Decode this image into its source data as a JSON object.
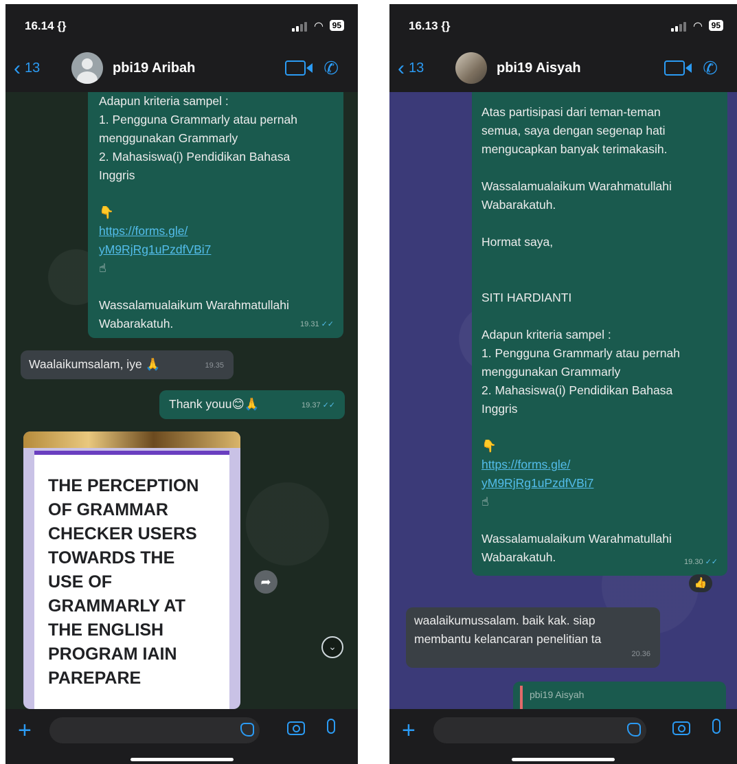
{
  "colors": {
    "accent": "#2b9bf4",
    "out_bubble": "#1a5a4e",
    "in_bubble": "#3a4045",
    "link": "#53bdeb"
  },
  "left": {
    "status": {
      "time": "16.14 {}",
      "battery": "95"
    },
    "header": {
      "back_count": "13",
      "contact_name": "pbi19 Aribah"
    },
    "msg1": {
      "lines": [
        "Adapun kriteria sampel :",
        "1. Pengguna Grammarly atau pernah",
        "menggunakan Grammarly",
        "2. Mahasiswa(i) Pendidikan Bahasa",
        "Inggris",
        "",
        "👇",
        "https://forms.gle/",
        "yM9RjRg1uPzdfVBi7",
        "☝",
        "",
        "Wassalamualaikum Warahmatullahi",
        "Wabarakatuh."
      ],
      "time": "19.31"
    },
    "msg2": {
      "text": "Waalaikumsalam, iye 🙏",
      "time": "19.35"
    },
    "msg3": {
      "text": "Thank youu😊🙏",
      "time": "19.37"
    },
    "card": {
      "title_lines": [
        "THE PERCEPTION",
        "OF GRAMMAR",
        "CHECKER USERS",
        "TOWARDS THE",
        "USE OF",
        "GRAMMARLY AT",
        "THE ENGLISH",
        "PROGRAM IAIN",
        "PAREPARE"
      ]
    }
  },
  "right": {
    "status": {
      "time": "16.13 {}",
      "battery": "95"
    },
    "header": {
      "back_count": "13",
      "contact_name": "pbi19 Aisyah"
    },
    "msg1": {
      "lines": [
        "Atas partisipasi dari teman-teman",
        "semua, saya dengan segenap hati",
        "mengucapkan banyak terimakasih.",
        "",
        "Wassalamualaikum Warahmatullahi",
        "Wabarakatuh.",
        "",
        "Hormat saya,",
        "",
        "",
        "SITI HARDIANTI",
        "",
        "Adapun kriteria sampel :",
        "1. Pengguna Grammarly atau pernah",
        "menggunakan Grammarly",
        "2. Mahasiswa(i) Pendidikan Bahasa",
        "Inggris",
        "",
        "👇",
        "https://forms.gle/",
        "yM9RjRg1uPzdfVBi7",
        "☝",
        "",
        "Wassalamualaikum Warahmatullahi",
        "Wabarakatuh."
      ],
      "time": "19.30",
      "reaction": "👍"
    },
    "msg2": {
      "lines": [
        "waalaikumussalam. baik kak. siap",
        "membantu kelancaran penelitian ta"
      ],
      "time": "20.36"
    },
    "msg3": {
      "quoted_sender": "pbi19 Aisyah"
    }
  }
}
